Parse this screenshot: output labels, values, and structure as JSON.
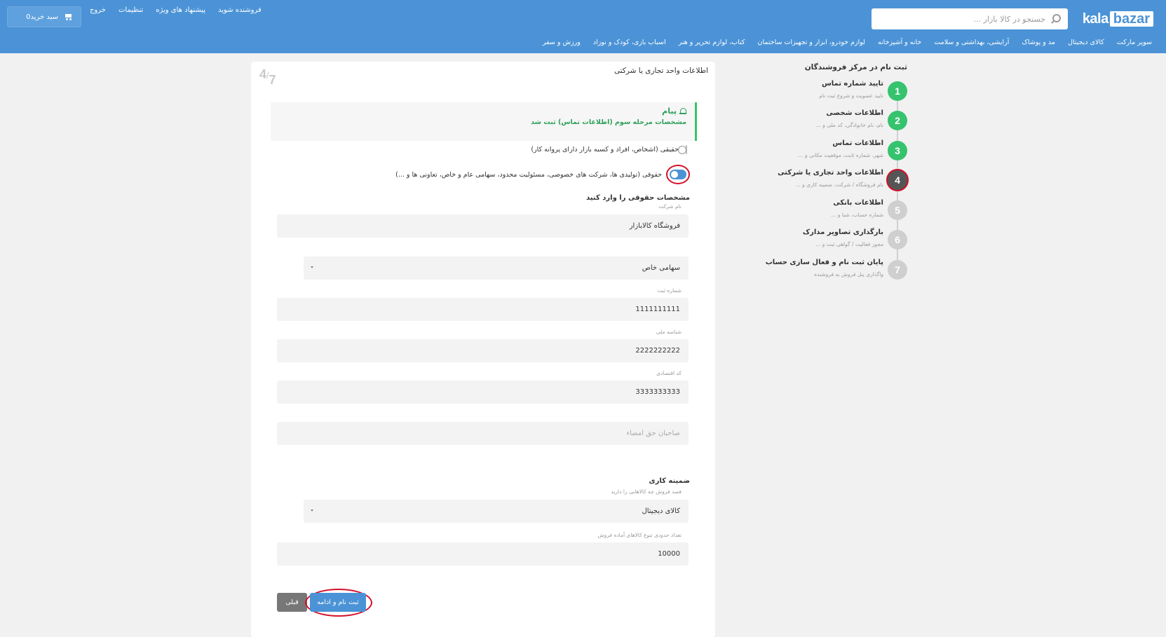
{
  "header": {
    "logo_left": "kala",
    "logo_right": "bazar",
    "search_placeholder": "جستجو در کالا بازار ...",
    "links": [
      "فروشنده شوید",
      "پیشنهاد های ویژه",
      "تنظیمات",
      "خروج"
    ],
    "cart_label": "سبد خرید",
    "cart_count": "0",
    "categories": [
      "سوپر مارکت",
      "کالای دیجیتال",
      "مد و پوشاک",
      "آرایشی، بهداشتی و سلامت",
      "خانه و آشپزخانه",
      "لوازم خودرو، ابزار و تجهیزات ساختمان",
      "کتاب، لوازم تحریر و هنر",
      "اسباب بازی، کودک و نوزاد",
      "ورزش و سفر"
    ],
    "color": "#4b93d6"
  },
  "sidebar": {
    "title": "ثبت نام در مرکز فروشندگان",
    "steps": [
      {
        "num": "1",
        "title": "تایید شماره تماس",
        "sub": "تایید عضویت و شروع ثبت نام",
        "state": "done"
      },
      {
        "num": "2",
        "title": "اطلاعات شخصی",
        "sub": "نام، نام خانوادگی، کد ملی و ...",
        "state": "done"
      },
      {
        "num": "3",
        "title": "اطلاعات تماس",
        "sub": "شهر، شماره ثابت، موقعیت مکانی و ...",
        "state": "done"
      },
      {
        "num": "4",
        "title": "اطلاعات واحد تجاری یا شرکتی",
        "sub": "نام فروشگاه / شرکت، ضمینه کاری و ...",
        "state": "active"
      },
      {
        "num": "5",
        "title": "اطلاعات بانکی",
        "sub": "شماره حساب، شبا و ...",
        "state": "pending"
      },
      {
        "num": "6",
        "title": "بارگذاری تصاویر مدارک",
        "sub": "مجوز فعالیت / گواهی ثبت و ...",
        "state": "pending"
      },
      {
        "num": "7",
        "title": "پایان ثبت نام و فعال سازی حساب",
        "sub": "واگذاری پنل فروش به فروشنده",
        "state": "pending"
      }
    ]
  },
  "card": {
    "title": "اطلاعات واحد تجاری یا شرکتی",
    "counter_num": "4",
    "counter_den": "7",
    "alert_title": "پیام",
    "alert_text": "مشخصات مرحله سوم (اطلاعات تماس) ثبت شد",
    "option_individual": "حقیقی (اشخاص، افراد و کسبه بازار دارای پروانه کار)",
    "option_legal": "حقوقی (تولیدی ها، شرکت های خصوصی، مسئولیت محدود، سهامی عام و خاص، تعاونی ها و ...)",
    "legal_section_title": "مشخصات حقوقی را وارد کنید",
    "company_name_label": "نام شرکت",
    "company_name": "فروشگاه کالابازار",
    "company_type": "سهامی خاص",
    "reg_number_label": "شماره ثبت",
    "reg_number": "1111111111",
    "national_id_label": "شناسه ملی",
    "national_id": "2222222222",
    "economic_code_label": "کد اقتصادی",
    "economic_code": "3333333333",
    "signatories_placeholder": "صاحبان حق امضاء",
    "field_section_title": "ضمینه کاری",
    "sell_intent_label": "قصد فروش چه کالاهایی را دارید",
    "sell_category": "کالای دیجیتال",
    "variety_label": "تعداد حدودی تنوع کالاهای آماده فروش",
    "variety": "10000",
    "btn_prev": "قبلی",
    "btn_next": "ثبت نام و ادامه"
  }
}
